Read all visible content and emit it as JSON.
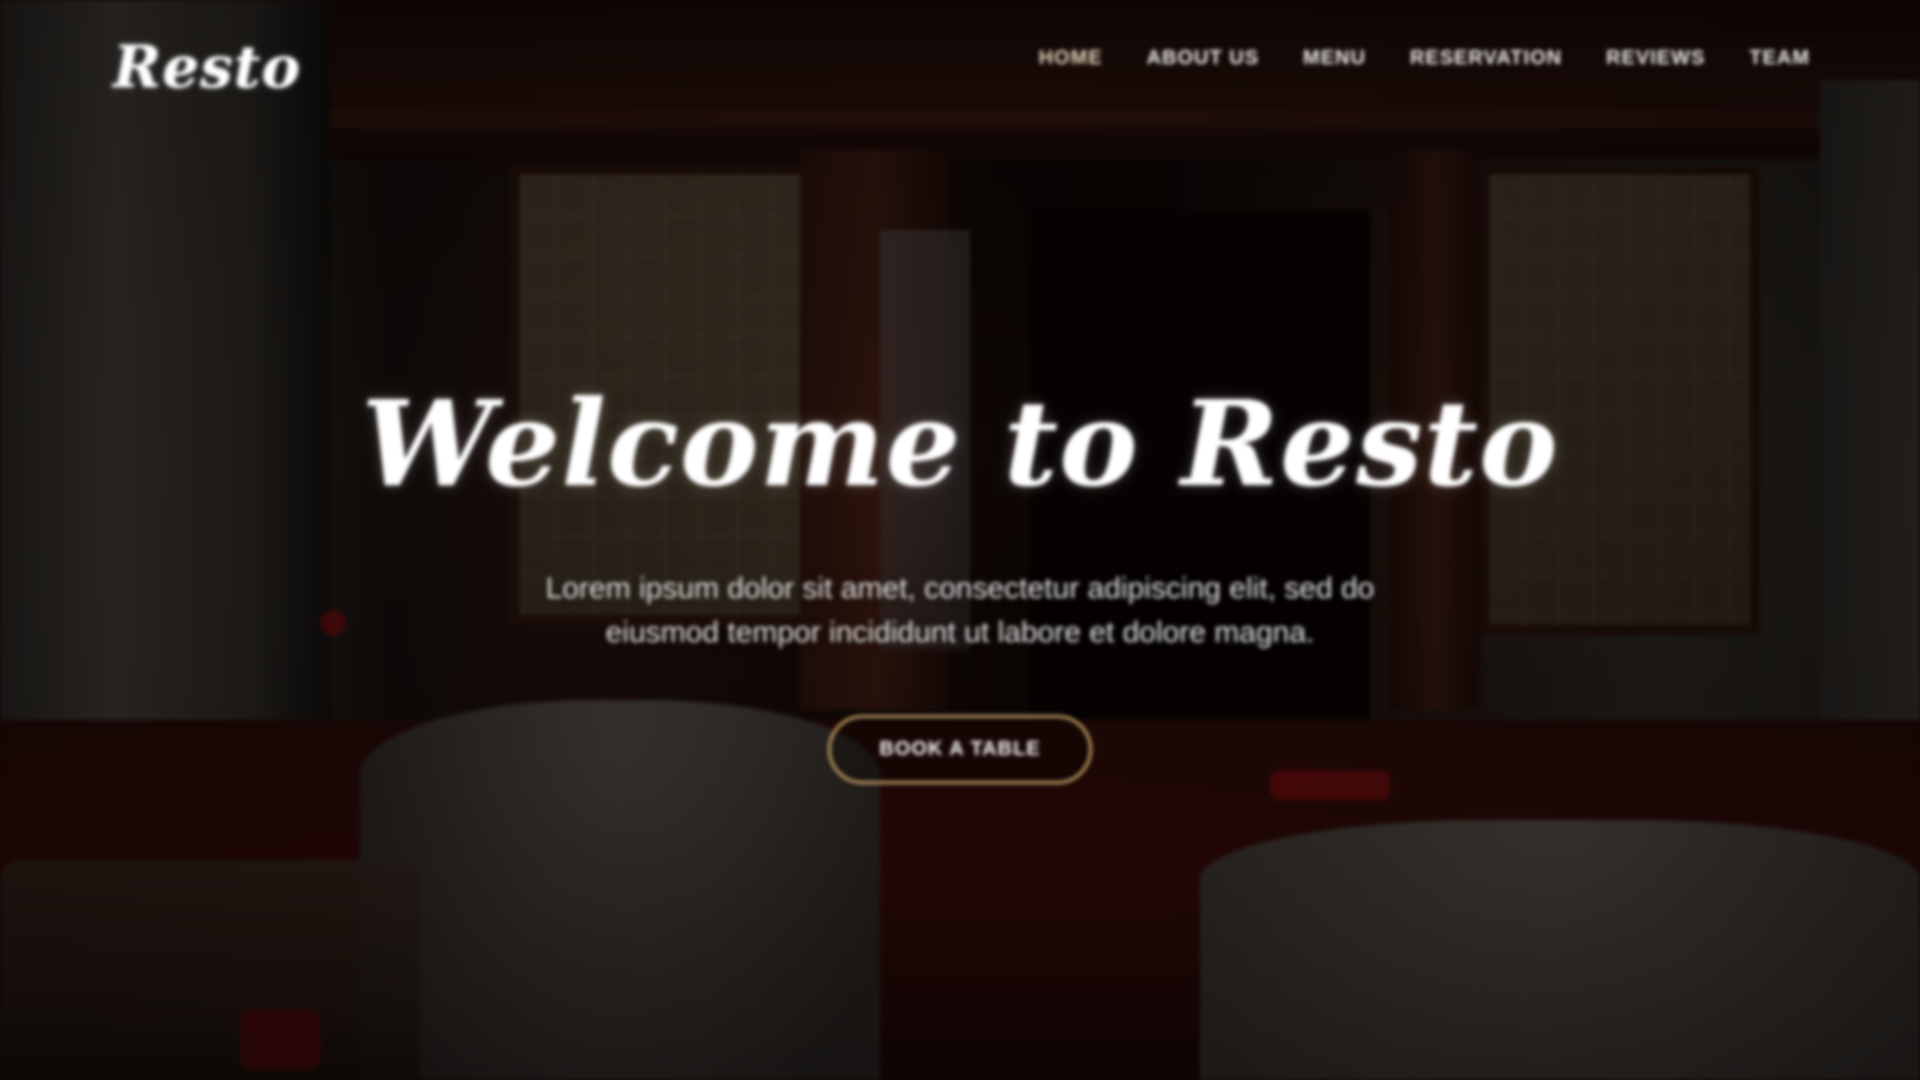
{
  "site": {
    "logo_text": "Resto"
  },
  "nav": {
    "items": [
      {
        "label": "Home"
      },
      {
        "label": "About Us"
      },
      {
        "label": "Menu"
      },
      {
        "label": "Reservation"
      },
      {
        "label": "Reviews"
      },
      {
        "label": "Team"
      }
    ],
    "active_index": 0
  },
  "hero": {
    "title": "Welcome to Resto",
    "subtitle": "Lorem ipsum dolor sit amet, consectetur adipiscing elit, sed do eiusmod tempor incididunt ut labore et dolore magna.",
    "cta_label": "Book a Table"
  },
  "colors": {
    "cta_border": "#c9a36a",
    "text": "#ffffff"
  }
}
